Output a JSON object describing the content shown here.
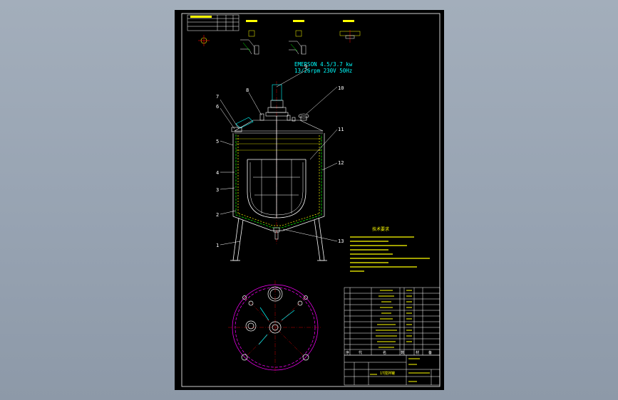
{
  "motor": {
    "line1": "EMERSON 4.5/3.7 kw",
    "line2": "13/26rpm 230V 50Hz"
  },
  "balloons": [
    "1",
    "2",
    "3",
    "4",
    "5",
    "6",
    "7",
    "8",
    "9",
    "10",
    "11",
    "12",
    "13"
  ],
  "notes_title": "技术要求",
  "title_block": {
    "drawing_name": "1T搅拌罐",
    "row_header_symbols": [
      "序",
      "代",
      "名",
      "数",
      "材",
      "备"
    ]
  },
  "colors": {
    "background": "#95a1b0",
    "sheet": "#000000",
    "frame": "#ffffff",
    "outline": "#ffffff",
    "jacket": "#00ff00",
    "insulation": "#ffff00",
    "annotation": "#00ffff",
    "plan_circle": "#ff00ff",
    "centerline": "#ff0000"
  }
}
